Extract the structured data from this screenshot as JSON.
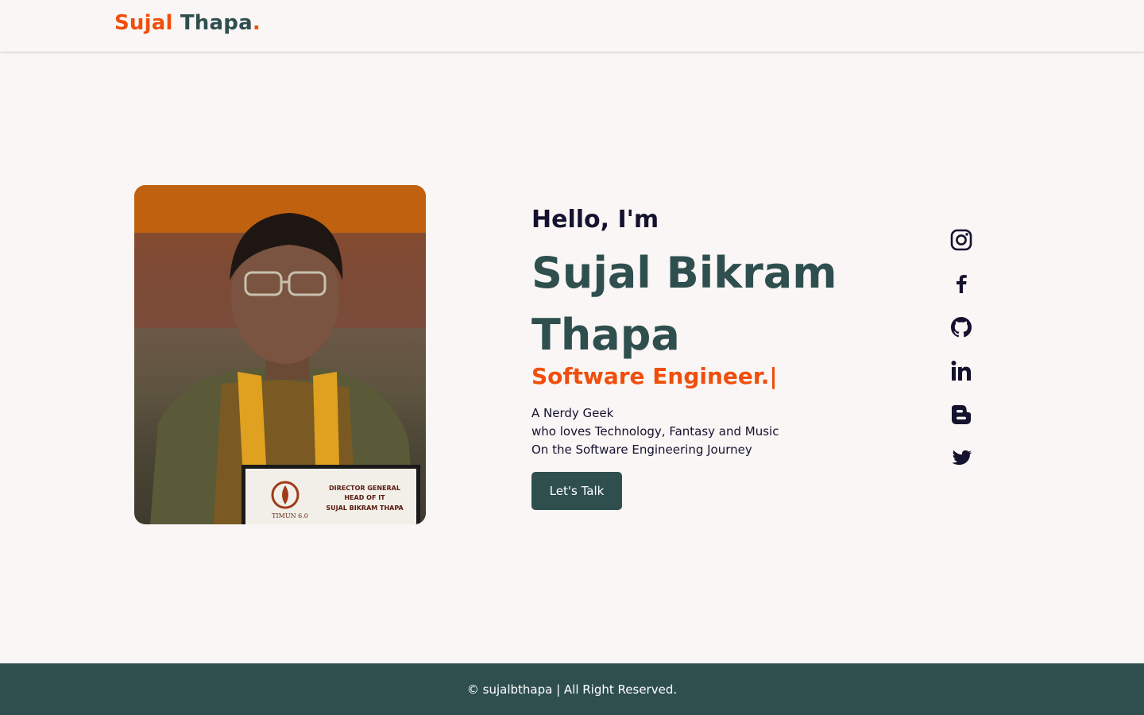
{
  "header": {
    "logo_first": "Sujal",
    "logo_last": "Thapa",
    "logo_dot": "."
  },
  "hero": {
    "greeting": "Hello, I'm",
    "name": "Sujal Bikram Thapa",
    "role": "Software Engineer.|",
    "bio": [
      "A Nerdy Geek",
      "who loves Technology, Fantasy and Music",
      "On the Software Engineering Journey"
    ],
    "cta_label": "Let's Talk",
    "photo": {
      "nameplate_lines": [
        "DIRECTOR GENERAL",
        "HEAD OF IT",
        "SUJAL BIKRAM THAPA"
      ],
      "logo_text": "TIMUN 6.0"
    }
  },
  "socials": [
    {
      "icon": "instagram-icon"
    },
    {
      "icon": "facebook-icon"
    },
    {
      "icon": "github-icon"
    },
    {
      "icon": "linkedin-icon"
    },
    {
      "icon": "blogger-icon"
    },
    {
      "icon": "twitter-icon"
    }
  ],
  "footer": {
    "text": "© sujalbthapa | All Right Reserved."
  },
  "colors": {
    "accent": "#f04e0c",
    "primary": "#2f4f4f",
    "background": "#f9f6f5",
    "text": "#14122e"
  }
}
